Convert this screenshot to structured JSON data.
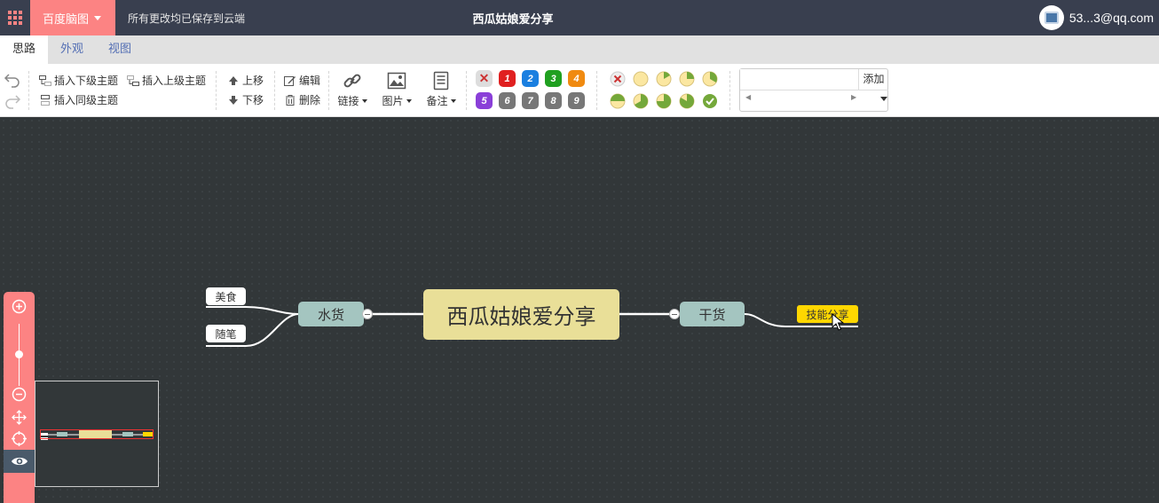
{
  "header": {
    "brand": "百度脑图",
    "save_status": "所有更改均已保存到云端",
    "doc_title": "西瓜姑娘爱分享",
    "user_email": "53...3@qq.com"
  },
  "tabs": [
    {
      "label": "思路",
      "active": true
    },
    {
      "label": "外观",
      "active": false
    },
    {
      "label": "视图",
      "active": false
    }
  ],
  "toolbar": {
    "insert_child": "插入下级主题",
    "insert_parent": "插入上级主题",
    "insert_sibling": "插入同级主题",
    "move_up": "上移",
    "move_down": "下移",
    "edit": "编辑",
    "delete": "删除",
    "link": "链接",
    "image": "图片",
    "note": "备注",
    "priorities": [
      "1",
      "2",
      "3",
      "4",
      "5",
      "6",
      "7",
      "8",
      "9"
    ],
    "resource_add": "添加",
    "resource_input_value": ""
  },
  "colors": {
    "accent": "#fc8383",
    "header_bg": "#393f4f",
    "root_bg": "#e9df98",
    "main_bg": "#a4c5c0",
    "selected_bg": "#ffd700"
  },
  "mindmap": {
    "root": "西瓜姑娘爱分享",
    "left_main": "水货",
    "left_children": [
      "美食",
      "随笔"
    ],
    "right_main": "干货",
    "right_children": [
      "技能分享"
    ]
  }
}
